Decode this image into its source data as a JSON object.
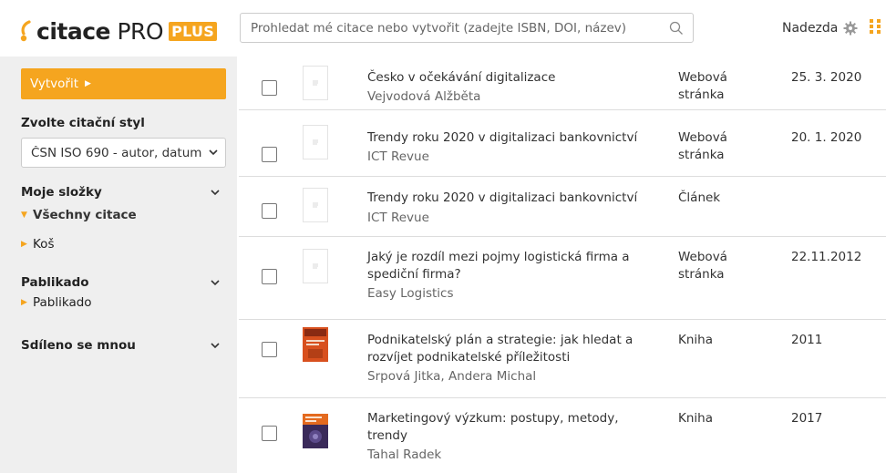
{
  "header": {
    "logo_word": "citace",
    "logo_pro": "PRO",
    "logo_badge": "PLUS",
    "search_placeholder": "Prohledat mé citace nebo vytvořit (zadejte ISBN, DOI, název)",
    "username": "Nadezda",
    "icons": [
      "search-icon",
      "gear-icon",
      "apps-grid-icon"
    ],
    "accent_color": "#f5a51f"
  },
  "sidebar": {
    "create_label": "Vytvořit",
    "citation_style_label": "Zvolte citační styl",
    "citation_style_value": "ČSN ISO 690 - autor, datum",
    "folders_heading": "Moje složky",
    "all_citations": "Všechny citace",
    "trash": "Koš",
    "group_heading": "Pablikado",
    "group_item": "Pablikado",
    "shared_heading": "Sdíleno se mnou"
  },
  "citations": [
    {
      "title": "Česko v očekávání digitalizace",
      "title2": "",
      "author": "Vejvodová Alžběta",
      "type": "Webová",
      "type2": "stránka",
      "date": "25. 3. 2020"
    },
    {
      "title": "Trendy roku 2020 v digitalizaci bankovnictví",
      "title2": "",
      "author": "ICT Revue",
      "type": "Webová",
      "type2": "stránka",
      "date": "20. 1. 2020"
    },
    {
      "title": "Trendy roku 2020 v digitalizaci bankovnictví",
      "title2": "",
      "author": "ICT Revue",
      "type": "Článek",
      "type2": "",
      "date": ""
    },
    {
      "title": "Jaký je rozdíl mezi pojmy logistická firma a",
      "title2": "spediční firma?",
      "author": "Easy Logistics",
      "type": "Webová",
      "type2": "stránka",
      "date": "22.11.2012"
    },
    {
      "title": "Podnikatelský plán a strategie: jak hledat a",
      "title2": "rozvíjet podnikatelské příležitosti",
      "author": "Srpová Jitka, Andera Michal",
      "type": "Kniha",
      "type2": "",
      "date": "2011"
    },
    {
      "title": "Marketingový výzkum: postupy, metody,",
      "title2": "trendy",
      "author": "Tahal Radek",
      "type": "Kniha",
      "type2": "",
      "date": "2017"
    }
  ]
}
